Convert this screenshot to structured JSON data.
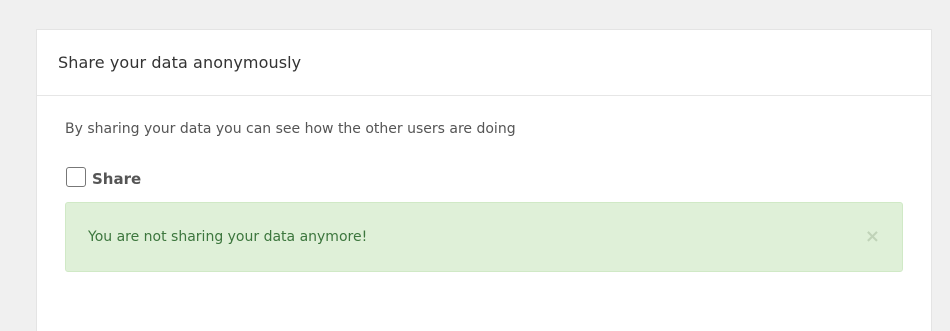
{
  "panel": {
    "title": "Share your data anonymously",
    "description": "By sharing your data you can see how the other users are doing",
    "share_checkbox": {
      "label": "Share",
      "checked": false
    },
    "alert": {
      "message": "You are not sharing your data anymore!",
      "close_glyph": "×",
      "type": "success",
      "background_color": "#dff0d8",
      "text_color": "#3c763d"
    }
  },
  "colors": {
    "page_background": "#f0f0f0",
    "panel_background": "#ffffff"
  }
}
